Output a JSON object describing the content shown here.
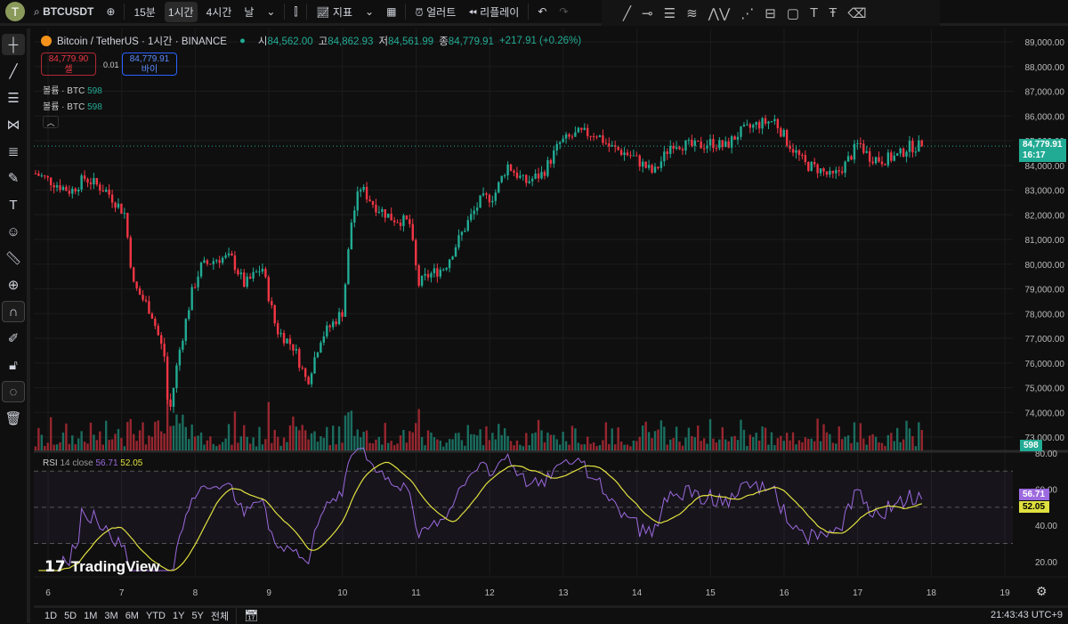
{
  "topbar": {
    "symbol": "BTCUSDT",
    "intervals": [
      "15분",
      "1시간",
      "4시간",
      "날"
    ],
    "active_interval": "1시간",
    "indicators": "지표",
    "alert": "얼러트",
    "replay": "리플레이",
    "avatar_letter": "T"
  },
  "legend": {
    "title": "Bitcoin / TetherUS · 1시간 · BINANCE",
    "open_label": "시",
    "open": "84,562.00",
    "high_label": "고",
    "high": "84,862.93",
    "low_label": "저",
    "low": "84,561.99",
    "close_label": "종",
    "close": "84,779.91",
    "change": "+217.91 (+0.26%)"
  },
  "trade": {
    "sell_price": "84,779.90",
    "sell_label": "셀",
    "spread": "0.01",
    "buy_price": "84,779.91",
    "buy_label": "바이"
  },
  "volume_legend": [
    {
      "label": "볼륨 · BTC",
      "value": "598"
    },
    {
      "label": "볼륨 · BTC",
      "value": "598"
    }
  ],
  "price_axis": {
    "labels": [
      "89,000.00",
      "88,000.00",
      "87,000.00",
      "86,000.00",
      "85,000.00",
      "84,000.00",
      "83,000.00",
      "82,000.00",
      "81,000.00",
      "80,000.00",
      "79,000.00",
      "78,000.00",
      "77,000.00",
      "76,000.00",
      "75,000.00",
      "74,000.00",
      "73,000.00"
    ],
    "last_price": "84,779.91",
    "countdown": "16:17",
    "volume_tag": "598"
  },
  "rsi": {
    "label": "RSI",
    "params": "14 close",
    "value": "56.71",
    "ma_value": "52.05",
    "axis": [
      "80.00",
      "60.00",
      "40.00",
      "20.00"
    ]
  },
  "time_axis": [
    "6",
    "7",
    "8",
    "9",
    "10",
    "11",
    "12",
    "13",
    "14",
    "15",
    "16",
    "17",
    "18",
    "19"
  ],
  "brand": "TradingView",
  "bottombar": {
    "ranges": [
      "1D",
      "5D",
      "1M",
      "3M",
      "6M",
      "YTD",
      "1Y",
      "5Y",
      "전체"
    ],
    "clock": "21:43:43 UTC+9"
  },
  "colors": {
    "up": "#22ab94",
    "down": "#f23645",
    "rsi": "#9c6ade",
    "rsi_ma": "#e0e040",
    "bg": "#0f0f0f"
  },
  "chart_data": {
    "type": "candlestick",
    "interval_hours": 1,
    "price_range": [
      73000,
      89000
    ],
    "x_range_days": [
      5.83,
      19.2
    ],
    "keypoints": [
      [
        5.83,
        83670
      ],
      [
        6.31,
        82950
      ],
      [
        6.5,
        83490
      ],
      [
        6.8,
        82950
      ],
      [
        7.04,
        82050
      ],
      [
        7.16,
        79160
      ],
      [
        7.4,
        78080
      ],
      [
        7.58,
        76280
      ],
      [
        7.64,
        73750
      ],
      [
        7.77,
        76280
      ],
      [
        7.95,
        78800
      ],
      [
        8.07,
        79880
      ],
      [
        8.31,
        80240
      ],
      [
        8.49,
        80240
      ],
      [
        8.67,
        79160
      ],
      [
        8.91,
        79880
      ],
      [
        9.1,
        77360
      ],
      [
        9.34,
        76640
      ],
      [
        9.52,
        75200
      ],
      [
        9.7,
        77000
      ],
      [
        10.0,
        78080
      ],
      [
        10.12,
        81690
      ],
      [
        10.24,
        83130
      ],
      [
        10.43,
        82400
      ],
      [
        10.67,
        81860
      ],
      [
        10.91,
        81690
      ],
      [
        11.03,
        79160
      ],
      [
        11.15,
        79520
      ],
      [
        11.39,
        79880
      ],
      [
        11.51,
        80600
      ],
      [
        11.7,
        81690
      ],
      [
        11.88,
        82590
      ],
      [
        12.06,
        82770
      ],
      [
        12.24,
        84030
      ],
      [
        12.48,
        83300
      ],
      [
        12.72,
        83670
      ],
      [
        12.96,
        84930
      ],
      [
        13.21,
        85290
      ],
      [
        13.45,
        85290
      ],
      [
        13.63,
        84750
      ],
      [
        13.93,
        84390
      ],
      [
        14.23,
        83670
      ],
      [
        14.48,
        84930
      ],
      [
        14.78,
        84750
      ],
      [
        15.02,
        84930
      ],
      [
        15.2,
        84750
      ],
      [
        15.38,
        85290
      ],
      [
        15.63,
        85650
      ],
      [
        15.87,
        85830
      ],
      [
        16.05,
        84930
      ],
      [
        16.29,
        84030
      ],
      [
        16.47,
        83850
      ],
      [
        16.65,
        83490
      ],
      [
        16.83,
        84030
      ],
      [
        17.02,
        84930
      ],
      [
        17.14,
        84390
      ],
      [
        17.32,
        84210
      ],
      [
        17.56,
        84390
      ],
      [
        17.68,
        84750
      ],
      [
        17.87,
        84779.91
      ]
    ],
    "rsi_period": 14,
    "rsi_ma_period": 14,
    "rsi_levels": [
      70,
      50,
      30
    ],
    "rsi_range": [
      10,
      85
    ]
  }
}
